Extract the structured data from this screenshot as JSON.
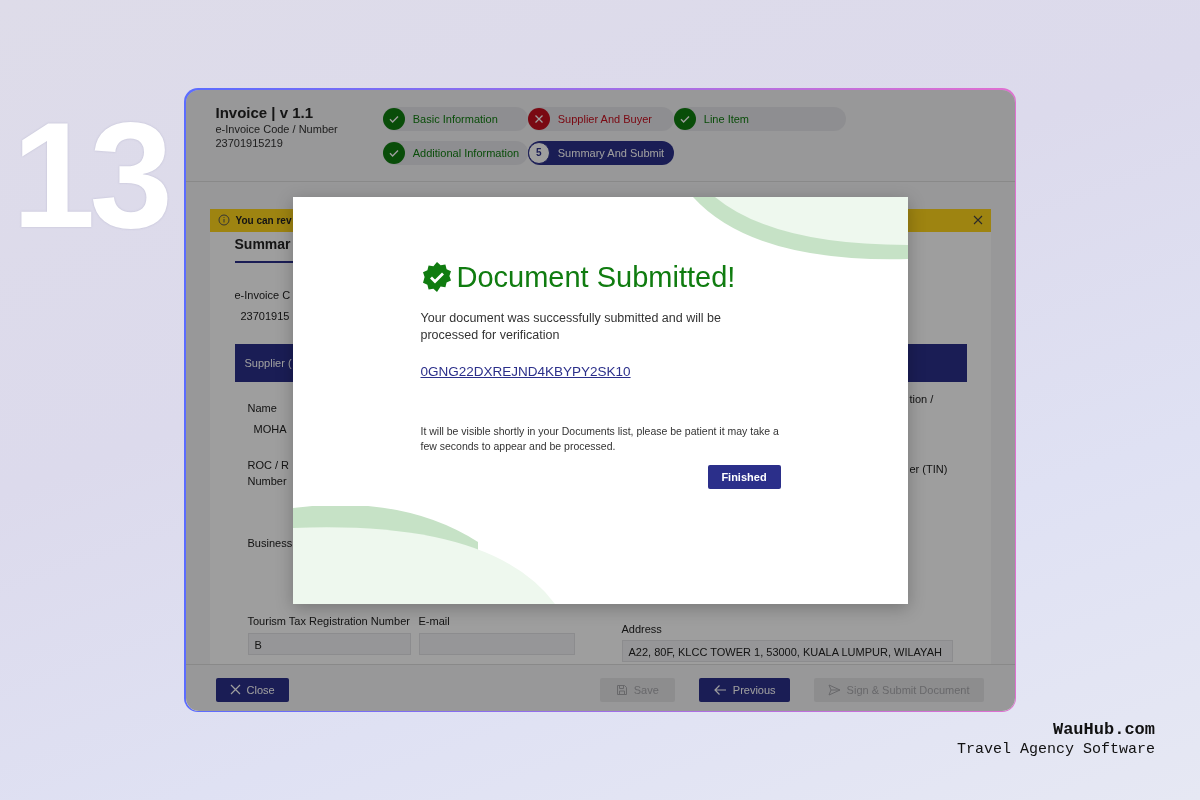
{
  "slide": {
    "number": "13",
    "brand": "WauHub.com",
    "tagline": "Travel Agency Software"
  },
  "header": {
    "title": "Invoice | v 1.1",
    "code_label": "e-Invoice Code / Number",
    "code": "23701915219"
  },
  "steps": [
    {
      "label": "Basic Information",
      "kind": "complete",
      "selected": false
    },
    {
      "label": "Supplier And Buyer",
      "kind": "error",
      "selected": false
    },
    {
      "label": "Line Item",
      "kind": "complete",
      "selected": false
    },
    {
      "label": "Additional Information",
      "kind": "complete",
      "selected": false
    },
    {
      "label": "Summary And Submit",
      "kind": "numbered",
      "selected": true,
      "number": "5"
    }
  ],
  "alert": {
    "text": "You can rev"
  },
  "form": {
    "heading": "Summar",
    "code_label": "e-Invoice C",
    "code_value": "23701915",
    "section": "Supplier (",
    "name_label": "Name",
    "name_value": "MOHA",
    "roc_label": "ROC / R",
    "roc_label_2": "Number",
    "business_label": "Business",
    "right_label_1": "tion /",
    "right_label_2": "er (TIN)",
    "tourism_label": "Tourism Tax Registration Number",
    "tourism_value": "B",
    "email_label": "E-mail",
    "address_label": "Address",
    "address_value": "A22, 80F, KLCC TOWER 1, 53000, KUALA LUMPUR, WILAYAH"
  },
  "modal": {
    "title": "Document Submitted!",
    "message": "Your document was successfully submitted and will be processed for verification",
    "link": "0GNG22DXREJND4KBYPY2SK10",
    "note": "It will be visible shortly in your Documents list, please be patient it may take a few seconds to appear and be processed.",
    "button": "Finished"
  },
  "buttons": [
    {
      "label": "Close",
      "disabled": false,
      "kind": "close"
    },
    {
      "label": "Save",
      "disabled": true,
      "kind": "save"
    },
    {
      "label": "Previous",
      "disabled": false,
      "kind": "back"
    },
    {
      "label": "Sign & Submit Document",
      "disabled": true,
      "kind": "submit"
    }
  ]
}
